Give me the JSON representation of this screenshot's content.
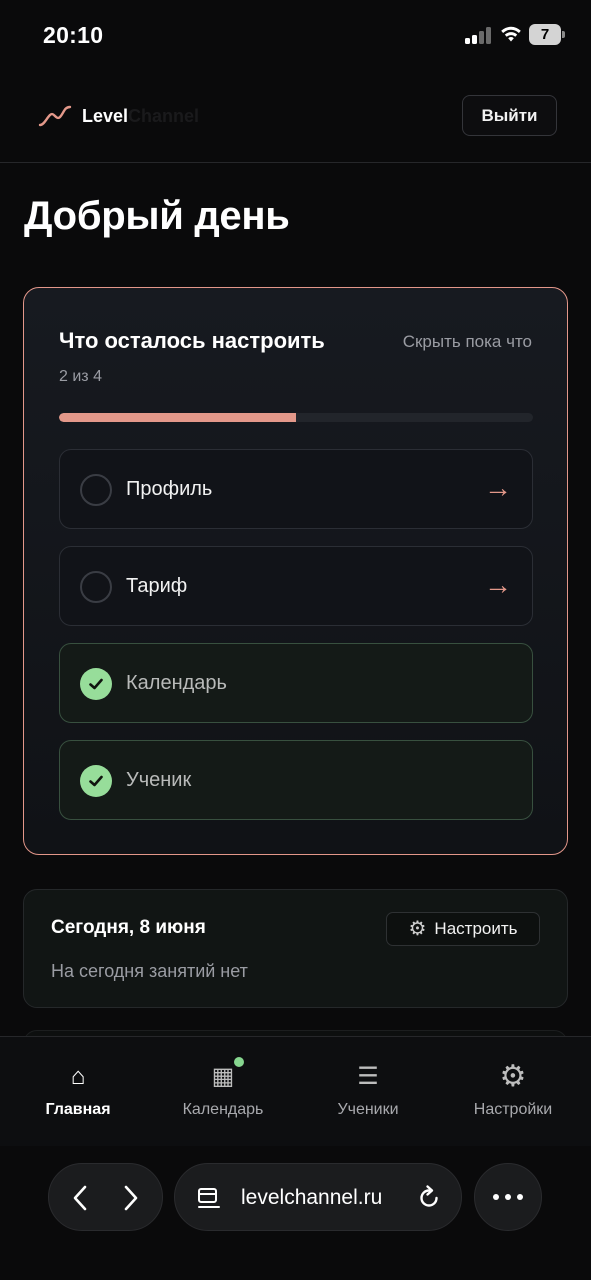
{
  "status_bar": {
    "time": "20:10",
    "battery": "7"
  },
  "header": {
    "brand_part_1": "Level",
    "brand_part_2": "Channel",
    "logout_label": "Выйти"
  },
  "greeting": "Добрый день",
  "setup": {
    "title": "Что осталось настроить",
    "hide_label": "Скрыть пока что",
    "count_text": "2 из 4",
    "progress": 0.5,
    "accent_color": "#e3988a",
    "steps": [
      {
        "label": "Профиль",
        "done": false,
        "arrow": "→"
      },
      {
        "label": "Тариф",
        "done": false,
        "arrow": "→"
      },
      {
        "label": "Календарь",
        "done": true
      },
      {
        "label": "Ученик",
        "done": true
      }
    ]
  },
  "today": {
    "title": "Сегодня, 8 июня",
    "configure_icon": "⚙",
    "configure_label": "Настроить",
    "empty_text": "На сегодня занятий нет"
  },
  "bottom_nav": {
    "items": [
      {
        "label": "Главная",
        "icon": "home-icon",
        "glyph": "⌂",
        "active": true
      },
      {
        "label": "Календарь",
        "icon": "calendar-icon",
        "glyph": "▦",
        "active": false,
        "badge": true
      },
      {
        "label": "Ученики",
        "icon": "list-icon",
        "glyph": "☰",
        "active": false
      },
      {
        "label": "Настройки",
        "icon": "gear-icon",
        "glyph": "⚙",
        "active": false
      }
    ]
  },
  "browser": {
    "url": "levelchannel.ru"
  },
  "colors": {
    "done_green": "#97dd9a",
    "badge_green": "#86d68f",
    "background": "#0a0a0b"
  }
}
